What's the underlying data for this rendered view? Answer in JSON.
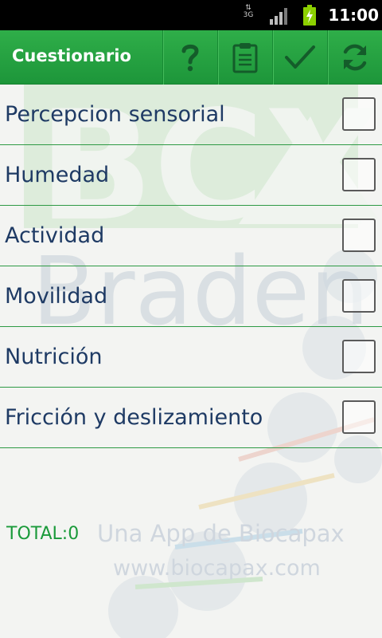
{
  "status_bar": {
    "network": "3G",
    "time": "11:00",
    "icons": [
      "data-arrows-icon",
      "signal-icon",
      "battery-charging-icon"
    ]
  },
  "action_bar": {
    "title": "Cuestionario",
    "actions": [
      {
        "name": "help",
        "icon": "question-icon"
      },
      {
        "name": "clipboard",
        "icon": "clipboard-icon"
      },
      {
        "name": "check",
        "icon": "checkmark-icon"
      },
      {
        "name": "refresh",
        "icon": "refresh-icon"
      }
    ]
  },
  "questions": [
    {
      "label": "Percepcion sensorial",
      "checked": false
    },
    {
      "label": "Humedad",
      "checked": false
    },
    {
      "label": "Actividad",
      "checked": false
    },
    {
      "label": "Movilidad",
      "checked": false
    },
    {
      "label": "Nutrición",
      "checked": false
    },
    {
      "label": "Fricción y deslizamiento",
      "checked": false
    }
  ],
  "total": "TOTAL:0",
  "watermark": {
    "logo": "BCX Braden",
    "line1": "Una App de Biocapax",
    "line2": "www.biocapax.com"
  },
  "colors": {
    "accent": "#1f9a3c",
    "label_text": "#1e3a64",
    "total_text": "#1a9a3a",
    "divider": "#2e9a45"
  }
}
